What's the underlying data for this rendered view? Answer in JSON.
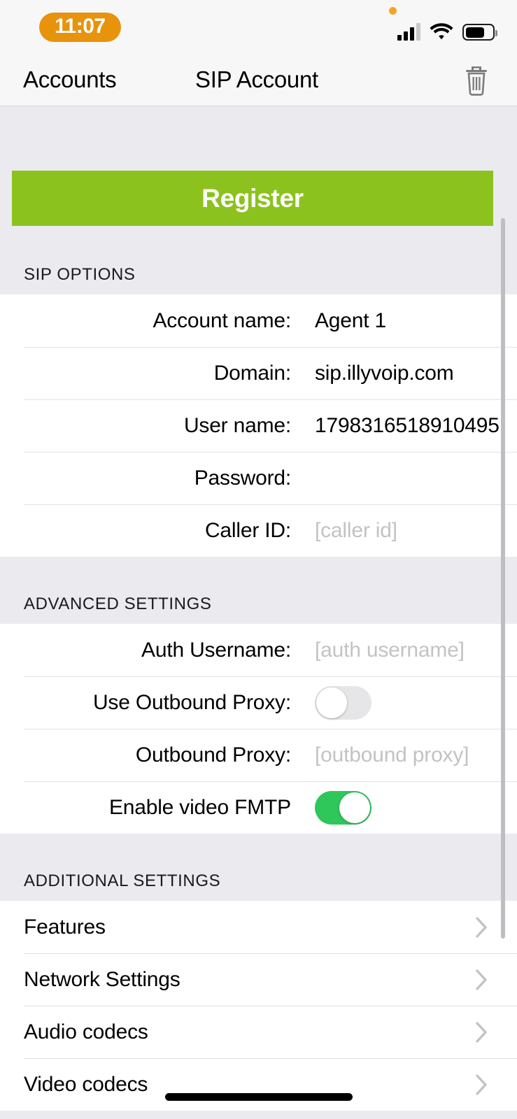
{
  "status_bar": {
    "time": "11:07",
    "time_pill_color": "#e8930c",
    "recording_dot_color": "#f5a623",
    "signal_icon": "cellular-signal-icon",
    "wifi_icon": "wifi-icon",
    "battery_icon": "battery-icon",
    "battery_level": "62%"
  },
  "nav": {
    "back_label": "Accounts",
    "title": "SIP Account",
    "delete_icon": "trash-icon"
  },
  "actions": {
    "register_label": "Register",
    "register_color": "#8cc21e"
  },
  "sections": [
    {
      "header": "SIP OPTIONS",
      "rows": [
        {
          "label": "Account name:",
          "value": "Agent 1",
          "placeholder": "",
          "type": "field"
        },
        {
          "label": "Domain:",
          "value": "sip.illyvoip.com",
          "placeholder": "",
          "type": "field"
        },
        {
          "label": "User name:",
          "value": "1798316518910495",
          "placeholder": "",
          "type": "field"
        },
        {
          "label": "Password:",
          "value": "",
          "placeholder": "",
          "type": "field"
        },
        {
          "label": "Caller ID:",
          "value": "",
          "placeholder": "[caller id]",
          "type": "field"
        }
      ]
    },
    {
      "header": "ADVANCED SETTINGS",
      "rows": [
        {
          "label": "Auth Username:",
          "value": "",
          "placeholder": "[auth username]",
          "type": "field"
        },
        {
          "label": "Use Outbound Proxy:",
          "type": "toggle",
          "state": "off"
        },
        {
          "label": "Outbound Proxy:",
          "value": "",
          "placeholder": "[outbound proxy]",
          "type": "field"
        },
        {
          "label": "Enable video FMTP",
          "type": "toggle",
          "state": "on"
        }
      ]
    },
    {
      "header": "ADDITIONAL SETTINGS",
      "rows": [
        {
          "label": "Features",
          "type": "link"
        },
        {
          "label": "Network Settings",
          "type": "link"
        },
        {
          "label": "Audio codecs",
          "type": "link"
        },
        {
          "label": "Video codecs",
          "type": "link"
        }
      ]
    }
  ],
  "toggle_colors": {
    "on": "#2fc65a",
    "off": "#e6e6e8"
  }
}
